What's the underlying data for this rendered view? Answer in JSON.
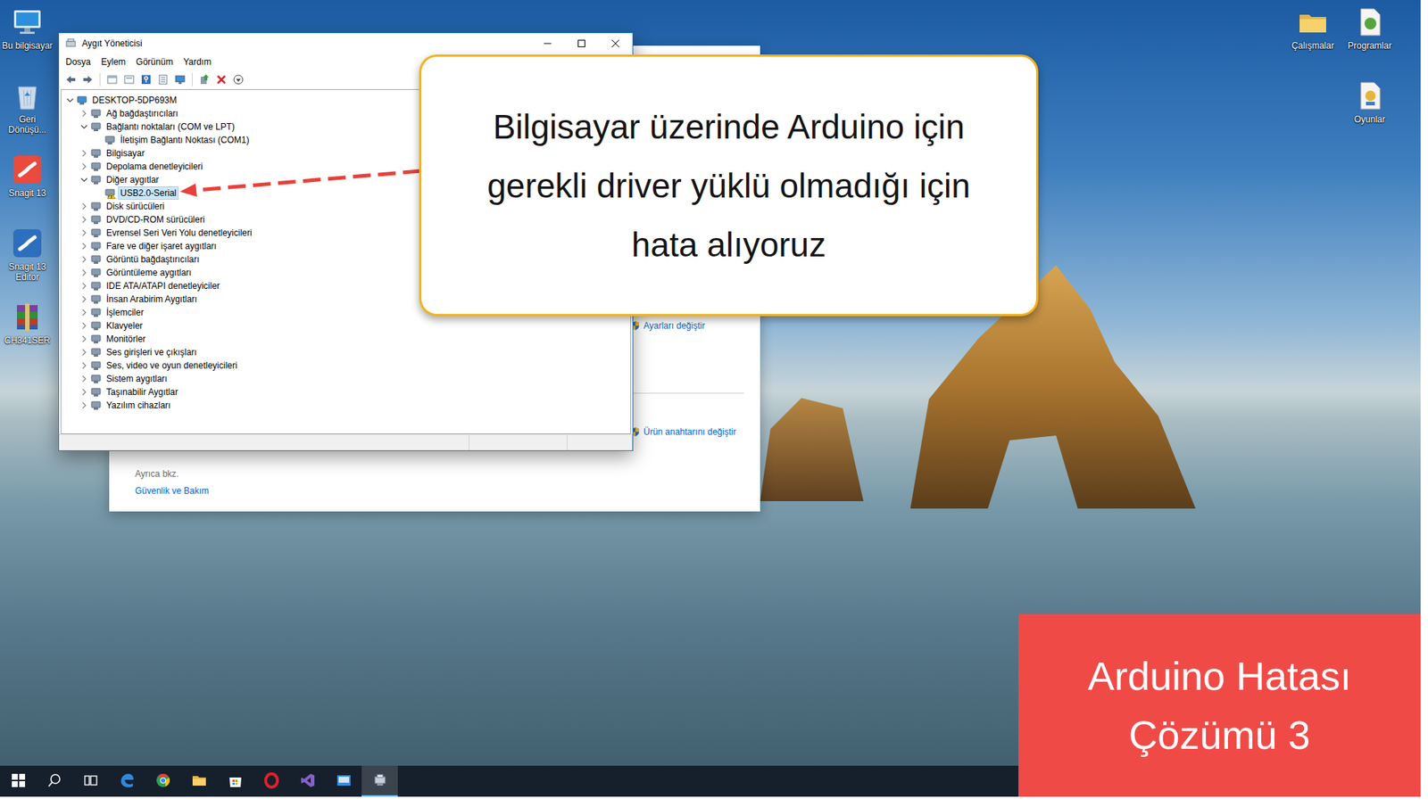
{
  "desktop": {
    "icons_left": [
      {
        "label": "Bu bilgisayar",
        "kind": "pc"
      },
      {
        "label": "Geri Dönüşü...",
        "kind": "recycle"
      },
      {
        "label": "Snagit 13",
        "kind": "snagit"
      },
      {
        "label": "Snagit 13 Editor",
        "kind": "snagit-editor"
      },
      {
        "label": "CH341SER",
        "kind": "archive"
      }
    ],
    "icons_right": [
      {
        "label": "Çalışmalar",
        "kind": "folder"
      },
      {
        "label": "Programlar",
        "kind": "programs"
      },
      {
        "label": "Oyunlar",
        "kind": "games"
      }
    ]
  },
  "background_window": {
    "links": [
      "Ayarları değiştir",
      "Ürün anahtarını değiştir"
    ],
    "see_also": {
      "heading": "Ayrıca bkz.",
      "link": "Güvenlik ve Bakım"
    }
  },
  "window": {
    "title": "Aygıt Yöneticisi"
  },
  "menu": [
    "Dosya",
    "Eylem",
    "Görünüm",
    "Yardım"
  ],
  "tree": {
    "root": {
      "label": "DESKTOP-5DP693M",
      "expanded": true,
      "selected": false
    },
    "categories": [
      {
        "label": "Ağ bağdaştırıcıları",
        "expanded": false,
        "selected": false,
        "children": []
      },
      {
        "label": "Bağlantı noktaları (COM ve LPT)",
        "expanded": true,
        "selected": false,
        "children": [
          {
            "label": "İletişim Bağlantı Noktası (COM1)",
            "selected": false,
            "warning": false
          }
        ]
      },
      {
        "label": "Bilgisayar",
        "expanded": false,
        "selected": false,
        "children": []
      },
      {
        "label": "Depolama denetleyicileri",
        "expanded": false,
        "selected": false,
        "children": []
      },
      {
        "label": "Diğer aygıtlar",
        "expanded": true,
        "selected": false,
        "children": [
          {
            "label": "USB2.0-Serial",
            "selected": true,
            "warning": true
          }
        ]
      },
      {
        "label": "Disk sürücüleri",
        "expanded": false,
        "selected": false,
        "children": []
      },
      {
        "label": "DVD/CD-ROM sürücüleri",
        "expanded": false,
        "selected": false,
        "children": []
      },
      {
        "label": "Evrensel Seri Veri Yolu denetleyicileri",
        "expanded": false,
        "selected": false,
        "children": []
      },
      {
        "label": "Fare ve diğer işaret aygıtları",
        "expanded": false,
        "selected": false,
        "children": []
      },
      {
        "label": "Görüntü bağdaştırıcıları",
        "expanded": false,
        "selected": false,
        "children": []
      },
      {
        "label": "Görüntüleme aygıtları",
        "expanded": false,
        "selected": false,
        "children": []
      },
      {
        "label": "IDE ATA/ATAPI denetleyiciler",
        "expanded": false,
        "selected": false,
        "children": []
      },
      {
        "label": "İnsan Arabirim Aygıtları",
        "expanded": false,
        "selected": false,
        "children": []
      },
      {
        "label": "İşlemciler",
        "expanded": false,
        "selected": false,
        "children": []
      },
      {
        "label": "Klavyeler",
        "expanded": false,
        "selected": false,
        "children": []
      },
      {
        "label": "Monitörler",
        "expanded": false,
        "selected": false,
        "children": []
      },
      {
        "label": "Ses girişleri ve çıkışları",
        "expanded": false,
        "selected": false,
        "children": []
      },
      {
        "label": "Ses, video ve oyun denetleyicileri",
        "expanded": false,
        "selected": false,
        "children": []
      },
      {
        "label": "Sistem aygıtları",
        "expanded": false,
        "selected": false,
        "children": []
      },
      {
        "label": "Taşınabilir Aygıtlar",
        "expanded": false,
        "selected": false,
        "children": []
      },
      {
        "label": "Yazılım cihazları",
        "expanded": false,
        "selected": false,
        "children": []
      }
    ]
  },
  "callout": {
    "lines": [
      "Bilgisayar üzerinde Arduino için",
      "gerekli driver yüklü olmadığı için",
      "hata alıyoruz"
    ]
  },
  "banner": {
    "lines": [
      "Arduino Hatası",
      "Çözümü 3"
    ]
  },
  "taskbar": [
    {
      "kind": "start",
      "selected": false
    },
    {
      "kind": "search",
      "selected": false
    },
    {
      "kind": "taskview",
      "selected": false
    },
    {
      "kind": "edge",
      "selected": false
    },
    {
      "kind": "chrome",
      "selected": false
    },
    {
      "kind": "explorer",
      "selected": false
    },
    {
      "kind": "store",
      "selected": false
    },
    {
      "kind": "opera",
      "selected": false
    },
    {
      "kind": "vs",
      "selected": false
    },
    {
      "kind": "app",
      "selected": false
    },
    {
      "kind": "devmgr",
      "selected": true
    }
  ]
}
